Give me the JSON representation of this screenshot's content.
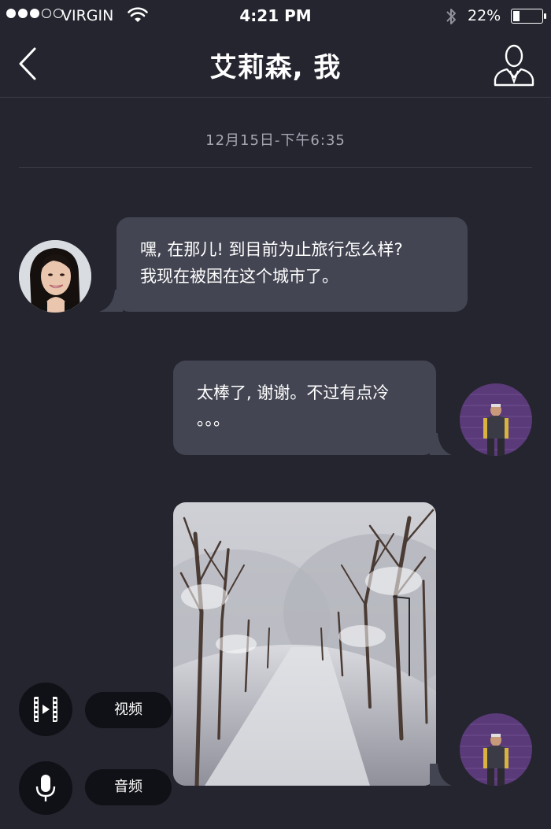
{
  "status_bar": {
    "carrier": "VIRGIN",
    "time": "4:21 PM",
    "battery": "22%",
    "battery_level": 0.22,
    "signal_strength": 3,
    "signal_max": 5
  },
  "nav": {
    "title": "艾莉森, 我",
    "back_icon": "chevron-left-icon",
    "profile_icon": "user-profile-icon"
  },
  "conversation": {
    "timestamp": "12月15日-下午6:35",
    "messages": [
      {
        "sender": "艾莉森",
        "direction": "incoming",
        "lines": [
          "嘿, 在那儿! 到目前为止旅行怎么样?",
          "我现在被困在这个城市了。"
        ]
      },
      {
        "sender": "我",
        "direction": "outgoing",
        "lines": [
          "太棒了, 谢谢。不过有点冷",
          "。。。"
        ]
      },
      {
        "sender": "我",
        "direction": "outgoing",
        "type": "image",
        "image_subject": "snow-covered-tree-lined-road"
      }
    ]
  },
  "media_actions": {
    "video_label": "视频",
    "video_icon": "film-icon",
    "audio_label": "音频",
    "audio_icon": "microphone-icon"
  },
  "colors": {
    "background": "#24252f",
    "bubble": "#434552",
    "button_bg": "#101116",
    "muted_text": "#a6a7b2"
  }
}
